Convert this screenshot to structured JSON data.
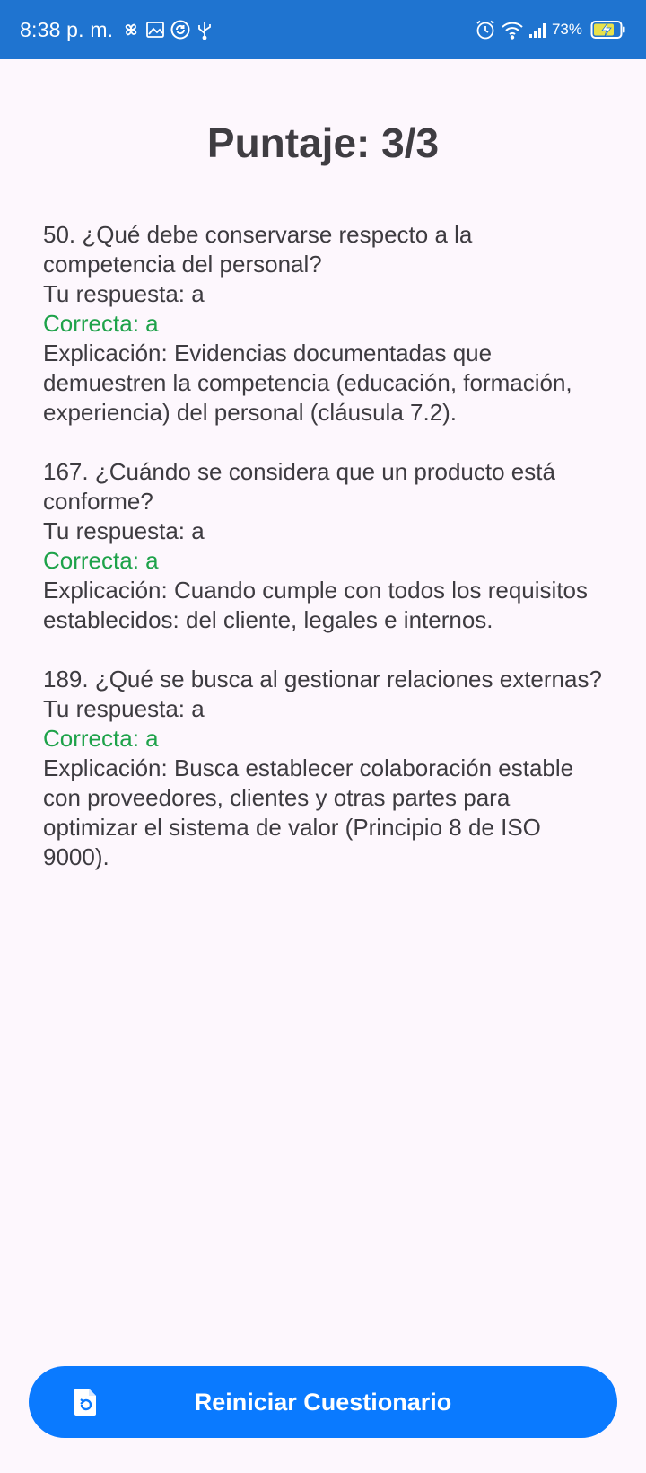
{
  "status_bar": {
    "time": "8:38 p. m.",
    "battery_percent": "73%",
    "icons_left": [
      "pinwheel-icon",
      "image-icon",
      "sync-icon",
      "usb-icon"
    ],
    "icons_right": [
      "alarm-icon",
      "wifi-icon",
      "signal-icon",
      "battery-charging-icon"
    ],
    "background_color": "#1f74d0"
  },
  "score": {
    "title": "Puntaje: 3/3"
  },
  "results": [
    {
      "question": "50. ¿Qué debe conservarse respecto a la competencia del personal?",
      "your_answer": "Tu respuesta: a",
      "correct": "Correcta: a",
      "explanation": "Explicación: Evidencias documentadas que demuestren la competencia (educación, formación, experiencia) del personal (cláusula 7.2)."
    },
    {
      "question": "167. ¿Cuándo se considera que un producto está conforme?",
      "your_answer": "Tu respuesta: a",
      "correct": "Correcta: a",
      "explanation": "Explicación: Cuando cumple con todos los requisitos establecidos: del cliente, legales e internos."
    },
    {
      "question": "189. ¿Qué se busca al gestionar relaciones externas?",
      "your_answer": "Tu respuesta: a",
      "correct": "Correcta: a",
      "explanation": "Explicación: Busca establecer colaboración estable con proveedores, clientes y otras partes para optimizar el sistema de valor (Principio 8 de ISO 9000)."
    }
  ],
  "restart_button": {
    "label": "Reiniciar Cuestionario",
    "icon": "restart-document-icon",
    "color": "#0a7aff"
  },
  "colors": {
    "correct": "#1ea24a",
    "text": "#3d3b40",
    "background": "#fdf7fd"
  }
}
